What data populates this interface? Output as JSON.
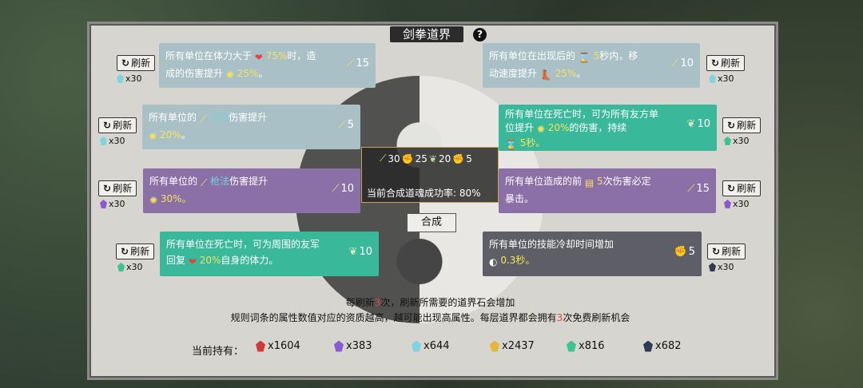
{
  "title": "剑拳道界",
  "help": "?",
  "refresh_label": "刷新",
  "cards": [
    {
      "id": "c1",
      "parts": [
        "所有单位在体力大于 ",
        "",
        "75%",
        "时，造",
        "\n",
        "成的伤害提升 ",
        "",
        "25%",
        "。"
      ],
      "cost": "15"
    },
    {
      "id": "c2",
      "parts": [
        "所有单位在出现后的 ",
        "",
        "5",
        "秒内，移",
        "\n",
        "动速度提升 ",
        "",
        "25%",
        "。"
      ],
      "cost": "10"
    },
    {
      "id": "c3",
      "text1": "所有单位的 ",
      "skill": "刀法",
      "text2": "伤害提升",
      "val": "20%",
      "cost": "5"
    },
    {
      "id": "c4",
      "text": "所有单位在死亡时，可为所有友方单",
      "text_b": "位提升 ",
      "val": "20%",
      "text_c": "的伤害，持续",
      "val2": "5秒。",
      "cost": "10"
    },
    {
      "id": "c5",
      "text1": "所有单位的 ",
      "skill": "枪法",
      "text2": "伤害提升",
      "val": "30%。",
      "cost": "10"
    },
    {
      "id": "c6",
      "text": "所有单位造成的前 ",
      "val": "5",
      "text2": "次伤害必定",
      "text3": "暴击。",
      "cost": "15"
    },
    {
      "id": "c7",
      "text": "所有单位在死亡时，可为周围的友军",
      "text_b": "回复 ",
      "val": "20%",
      "text_c": "自身的体力。",
      "cost": "10"
    },
    {
      "id": "c8",
      "text": "所有单位的技能冷却时间增加",
      "val": "0.3秒。",
      "cost": "5"
    }
  ],
  "refresh_costs": [
    "x30",
    "x30",
    "x30",
    "x30",
    "x30",
    "x30",
    "x30",
    "x30"
  ],
  "middle": {
    "res": [
      "30",
      "25",
      "20",
      "5"
    ],
    "rate": "当前合成道魂成功率: 80%"
  },
  "craft": "合成",
  "info1_a": "每刷新",
  "info1_b": "3",
  "info1_c": "次，刷新所需要的道界石会增加",
  "info2_a": "规则词条的属性数值对应的资质越高，越可能出现高属性。每层道界都会拥有",
  "info2_b": "3",
  "info2_c": "次免费刷新机会",
  "holding_label": "当前持有：",
  "holdings": [
    {
      "count": "x1604",
      "color": "#d23a3a"
    },
    {
      "count": "x383",
      "color": "#8a5bd0"
    },
    {
      "count": "x644",
      "color": "#7fd4e0"
    },
    {
      "count": "x2437",
      "color": "#e8b63a"
    },
    {
      "count": "x816",
      "color": "#3cc48e"
    },
    {
      "count": "x682",
      "color": "#2e3b55"
    }
  ]
}
